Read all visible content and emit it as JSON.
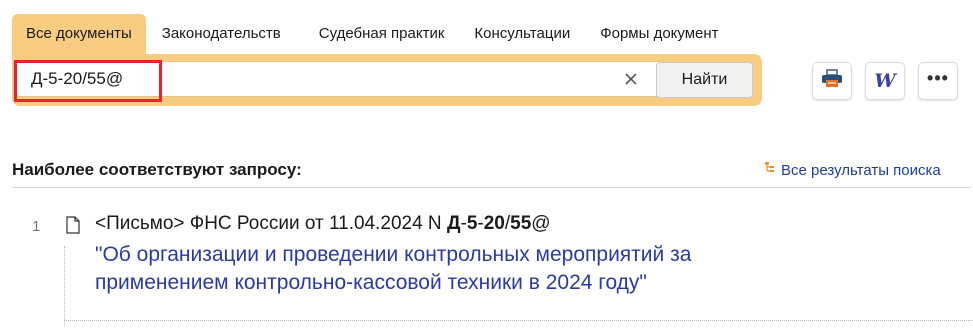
{
  "tabs": [
    {
      "label": "Все документы",
      "active": true
    },
    {
      "label": "Законодательств",
      "active": false
    },
    {
      "label": "Судебная практик",
      "active": false
    },
    {
      "label": "Консультации",
      "active": false
    },
    {
      "label": "Формы документ",
      "active": false
    }
  ],
  "search": {
    "value": "Д-5-20/55@",
    "button_label": "Найти"
  },
  "toolbar": {
    "print_icon": "printer-icon",
    "word_icon": "word-export-icon",
    "word_glyph": "W",
    "more_icon": "more-dots-icon",
    "more_glyph": "•••"
  },
  "results": {
    "heading": "Наиболее соответствуют запросу:",
    "all_results_label": "Все результаты поиска",
    "items": [
      {
        "number": "1",
        "meta_prefix": "<Письмо> ФНС России от 11.04.2024 N ",
        "meta_code_parts": [
          "Д",
          "-",
          "5",
          "-",
          "20",
          "/",
          "55",
          "@"
        ],
        "title": "\"Об организации и проведении контрольных мероприятий за применением контрольно-кассовой техники в 2024 году\""
      }
    ]
  },
  "colors": {
    "accent": "#f8cd82",
    "highlight_border": "#e8232b",
    "link": "#2a3aa5",
    "all_results_icon": "#f28c1c"
  }
}
